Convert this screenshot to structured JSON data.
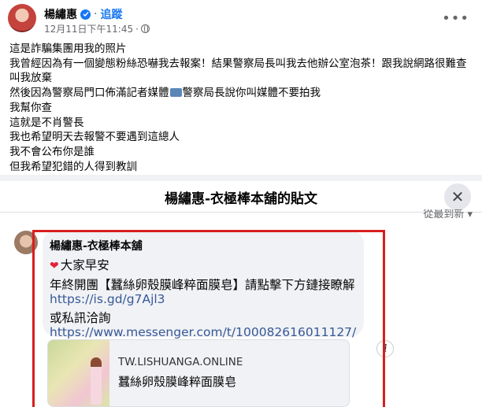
{
  "post": {
    "author": "楊繡惠",
    "separator": "·",
    "follow_label": "追蹤",
    "timestamp": "12月11日下午11:45",
    "meta_separator": "·",
    "more_icon": "more-horizontal-icon",
    "lines": [
      "這是詐騙集團用我的照片",
      "我曾經因為有一個變態粉絲恐嚇我去報案！結果警察局長叫我去他辦公室泡茶！跟我說網路很難查",
      "叫我放棄",
      "然後因為警察局門口佈滿記者媒體",
      "警察局長說你叫媒體不要拍我",
      "我幫你查",
      "這就是不肖警長",
      "我也希望明天去報警不要遇到這總人",
      "我不會公布你是誰",
      "但我希望犯錯的人得到教訓"
    ]
  },
  "screenshot": {
    "title": "楊繡惠-衣極棒本舖的貼文",
    "close_label": "✕",
    "sort_label": "從最到新 ▾",
    "comment": {
      "author": "楊繡惠-衣極棒本舖",
      "greeting": "大家早安",
      "promo": "年終開團【蠶絲卵殼膜峰粹面膜皂】請點擊下方鏈接瞭解",
      "link1": "https://is.gd/g7Ajl3",
      "dm_text": "或私訊洽詢",
      "link2": "https://www.messenger.com/t/100082616011127/"
    },
    "preview": {
      "domain": "TW.LISHUANGA.ONLINE",
      "title": "蠶絲卵殼膜峰粹面膜皂",
      "info_label": "i"
    }
  },
  "colors": {
    "link": "#385898",
    "accent": "#1877f2",
    "highlight_box": "#d91e1e"
  }
}
